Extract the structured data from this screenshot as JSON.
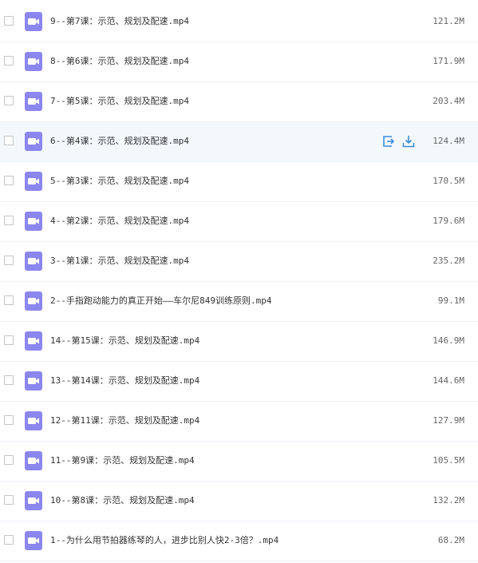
{
  "files": [
    {
      "name": "9--第7课：示范、规划及配速.mp4",
      "size": "121.2M",
      "hover": false
    },
    {
      "name": "8--第6课：示范、规划及配速.mp4",
      "size": "171.9M",
      "hover": false
    },
    {
      "name": "7--第5课：示范、规划及配速.mp4",
      "size": "203.4M",
      "hover": false
    },
    {
      "name": "6--第4课：示范、规划及配速.mp4",
      "size": "124.4M",
      "hover": true
    },
    {
      "name": "5--第3课：示范、规划及配速.mp4",
      "size": "170.5M",
      "hover": false
    },
    {
      "name": "4--第2课：示范、规划及配速.mp4",
      "size": "179.6M",
      "hover": false
    },
    {
      "name": "3--第1课：示范、规划及配速.mp4",
      "size": "235.2M",
      "hover": false
    },
    {
      "name": "2--手指跑动能力的真正开始——车尔尼849训练原则.mp4",
      "size": "99.1M",
      "hover": false
    },
    {
      "name": "14--第15课：示范、规划及配速.mp4",
      "size": "146.9M",
      "hover": false
    },
    {
      "name": "13--第14课：示范、规划及配速.mp4",
      "size": "144.6M",
      "hover": false
    },
    {
      "name": "12--第11课：示范、规划及配速.mp4",
      "size": "127.9M",
      "hover": false
    },
    {
      "name": "11--第9课：示范、规划及配速.mp4",
      "size": "105.5M",
      "hover": false
    },
    {
      "name": "10--第8课：示范、规划及配速.mp4",
      "size": "132.2M",
      "hover": false
    },
    {
      "name": "1--为什么用节拍器练琴的人，进步比别人快2-3倍？.mp4",
      "size": "68.2M",
      "hover": false
    }
  ],
  "icons": {
    "file_type": "video-file-icon",
    "share": "share-icon",
    "download": "download-icon"
  },
  "colors": {
    "video_icon": "#8c86ef",
    "action_icon": "#3b8cde",
    "hover_row": "#f3f8fd",
    "divider": "#eef0f6"
  }
}
